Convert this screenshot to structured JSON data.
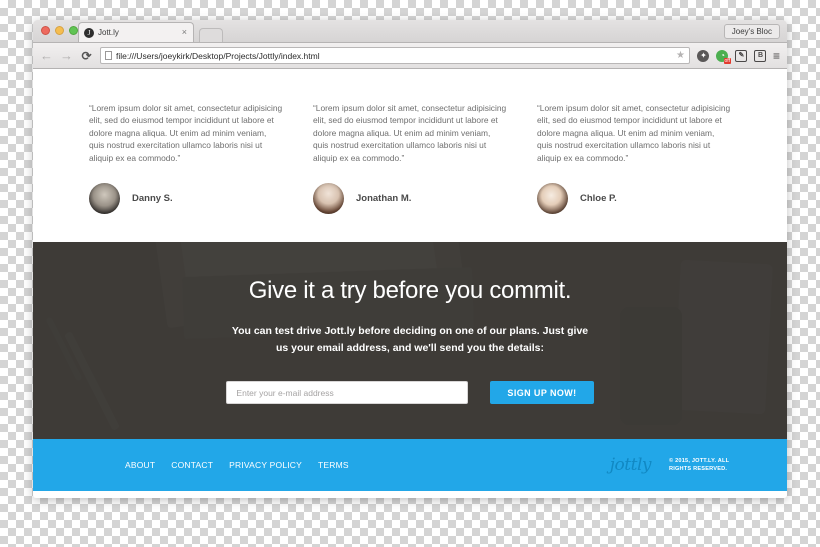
{
  "browser": {
    "traffic_lights": [
      "close",
      "minimize",
      "maximize"
    ],
    "tab": {
      "favicon": "jottly-favicon",
      "title": "Jott.ly",
      "close_label": "×"
    },
    "profile_label": "Joey's Bloc",
    "nav": {
      "back": "←",
      "forward": "→",
      "reload": "⟳"
    },
    "url": "file:///Users/joeykirk/Desktop/Projects/Jottly/index.html",
    "star": "★",
    "extensions": [
      {
        "name": "adblock-icon",
        "glyph": "✦",
        "badge": ""
      },
      {
        "name": "privacy-badger-icon",
        "glyph": "◔",
        "badge": "off"
      },
      {
        "name": "edit-note-icon",
        "glyph": "✎",
        "badge": ""
      },
      {
        "name": "bitwarden-icon",
        "glyph": "B",
        "badge": ""
      },
      {
        "name": "browser-menu-icon",
        "glyph": "≡",
        "badge": ""
      }
    ]
  },
  "page": {
    "testimonials": [
      {
        "quote": "“Lorem ipsum dolor sit amet, consectetur adipisicing elit, sed do eiusmod tempor incididunt ut labore et dolore magna aliqua. Ut enim ad minim veniam, quis nostrud exercitation ullamco laboris nisi ut aliquip ex ea commodo.”",
        "author": "Danny S.",
        "avatar": "avatar-danny"
      },
      {
        "quote": "“Lorem ipsum dolor sit amet, consectetur adipisicing elit, sed do eiusmod tempor incididunt ut labore et dolore magna aliqua. Ut enim ad minim veniam, quis nostrud exercitation ullamco laboris nisi ut aliquip ex ea commodo.”",
        "author": "Jonathan M.",
        "avatar": "avatar-jonathan"
      },
      {
        "quote": "“Lorem ipsum dolor sit amet, consectetur adipisicing elit, sed do eiusmod tempor incididunt ut labore et dolore magna aliqua. Ut enim ad minim veniam, quis nostrud exercitation ullamco laboris nisi ut aliquip ex ea commodo.”",
        "author": "Chloe P.",
        "avatar": "avatar-chloe"
      }
    ],
    "cta": {
      "title": "Give it a try before you commit.",
      "subtitle": "You can test drive Jott.ly before deciding on one of our plans. Just give us your email address, and we'll send you the details:",
      "email_placeholder": "Enter your e-mail address",
      "email_value": "",
      "signup_label": "SIGN UP NOW!"
    },
    "footer": {
      "links": [
        "ABOUT",
        "CONTACT",
        "PRIVACY POLICY",
        "TERMS"
      ],
      "logo": "jottly",
      "copyright": "© 2015, JOTT.LY. ALL RIGHTS RESERVED."
    }
  },
  "colors": {
    "accent": "#22a7e8",
    "cta_background": "#3a3834",
    "text_muted": "#6f6f6f"
  }
}
